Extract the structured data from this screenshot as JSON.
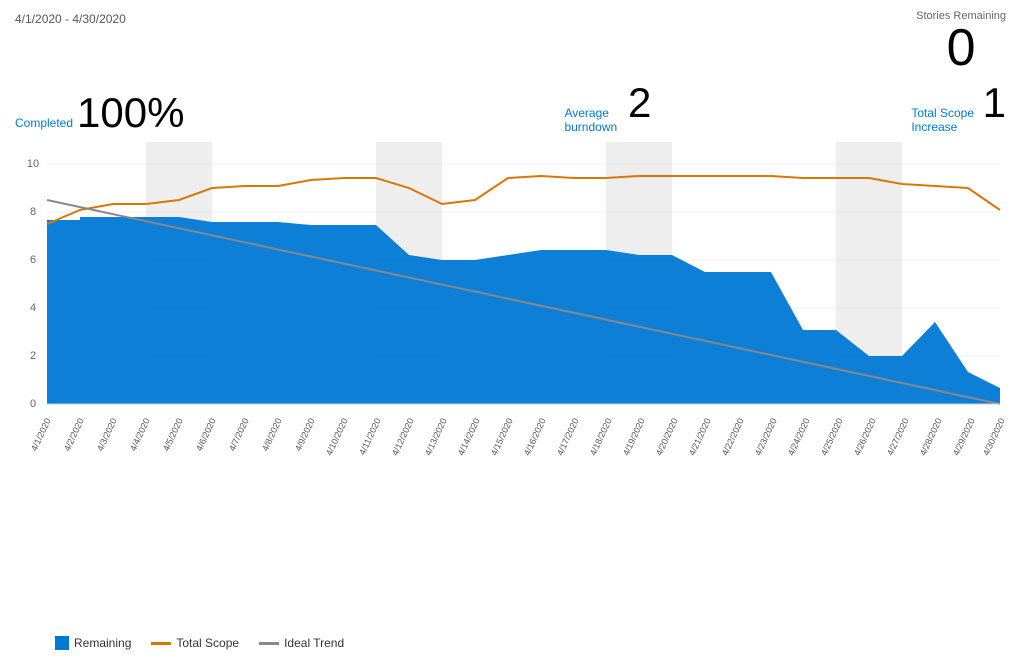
{
  "header": {
    "date_range": "4/1/2020 - 4/30/2020",
    "stories_remaining_label": "Stories Remaining",
    "stories_remaining_value": "0"
  },
  "stats": {
    "completed_label": "Completed",
    "completed_value": "100%",
    "avg_burndown_label": "Average burndown",
    "avg_burndown_value": "2",
    "total_scope_label": "Total Scope Increase",
    "total_scope_value": "1"
  },
  "legend": {
    "remaining_label": "Remaining",
    "total_scope_label": "Total Scope",
    "ideal_trend_label": "Ideal Trend"
  },
  "colors": {
    "blue": "#0078d4",
    "orange": "#d97706",
    "gray": "#888",
    "weekend_fill": "rgba(200,200,200,0.35)"
  }
}
